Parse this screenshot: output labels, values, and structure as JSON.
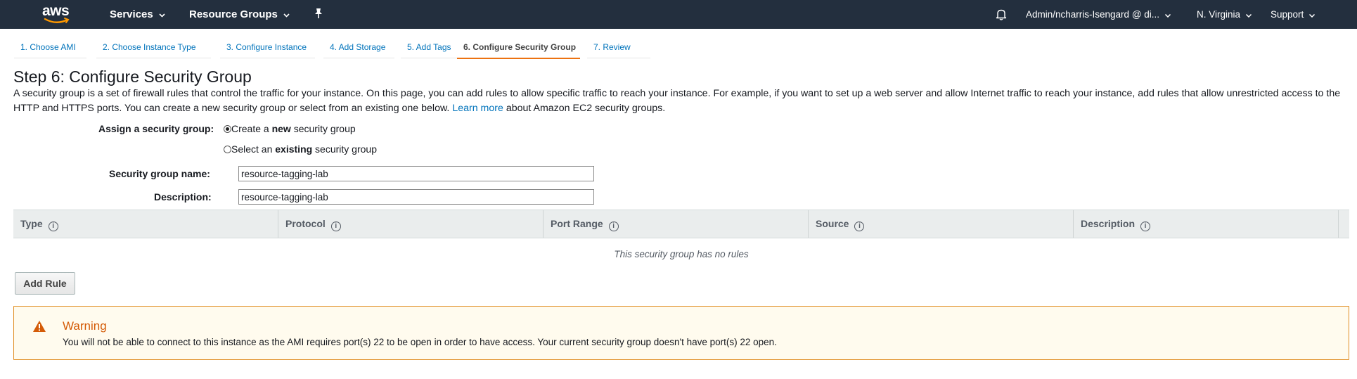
{
  "colors": {
    "nav_bg": "#232f3e",
    "link": "#0073bb",
    "tab_active_underline": "#ec7211",
    "warning_border": "#e08b1f",
    "warning_title": "#d45b07",
    "warning_bg": "#fffbee"
  },
  "nav": {
    "logo": "aws",
    "services": "Services",
    "resource_groups": "Resource Groups",
    "pin_icon": "pin-icon",
    "bell_icon": "bell-icon",
    "account": "Admin/ncharris-Isengard @ di...",
    "region": "N. Virginia",
    "support": "Support"
  },
  "tabs": [
    {
      "label": "1. Choose AMI"
    },
    {
      "label": "2. Choose Instance Type"
    },
    {
      "label": "3. Configure Instance"
    },
    {
      "label": "4. Add Storage"
    },
    {
      "label": "5. Add Tags"
    },
    {
      "label": "6. Configure Security Group",
      "active": true
    },
    {
      "label": "7. Review"
    }
  ],
  "step": {
    "title": "Step 6: Configure Security Group",
    "intro_text": "A security group is a set of firewall rules that control the traffic for your instance. On this page, you can add rules to allow specific traffic to reach your instance. For example, if you want to set up a web server and allow Internet traffic to reach your instance, add rules that allow unrestricted access to the HTTP and HTTPS ports. You can create a new security group or select from an existing one below.",
    "learn_more": "Learn more",
    "intro_suffix": "about Amazon EC2 security groups."
  },
  "form": {
    "assign_label": "Assign a security group:",
    "option_new": {
      "pre": "Create a ",
      "bold": "new",
      "post": " security group",
      "selected": true
    },
    "option_existing": {
      "pre": "Select an ",
      "bold": "existing",
      "post": " security group",
      "selected": false
    },
    "name_label": "Security group name:",
    "name_value": "resource-tagging-lab",
    "desc_label": "Description:",
    "desc_value": "resource-tagging-lab"
  },
  "rules_table": {
    "columns": [
      "Type",
      "Protocol",
      "Port Range",
      "Source",
      "Description"
    ],
    "empty_text": "This security group has no rules",
    "add_rule": "Add Rule"
  },
  "warning": {
    "title": "Warning",
    "text": "You will not be able to connect to this instance as the AMI requires port(s) 22 to be open in order to have access. Your current security group doesn't have port(s) 22 open."
  }
}
